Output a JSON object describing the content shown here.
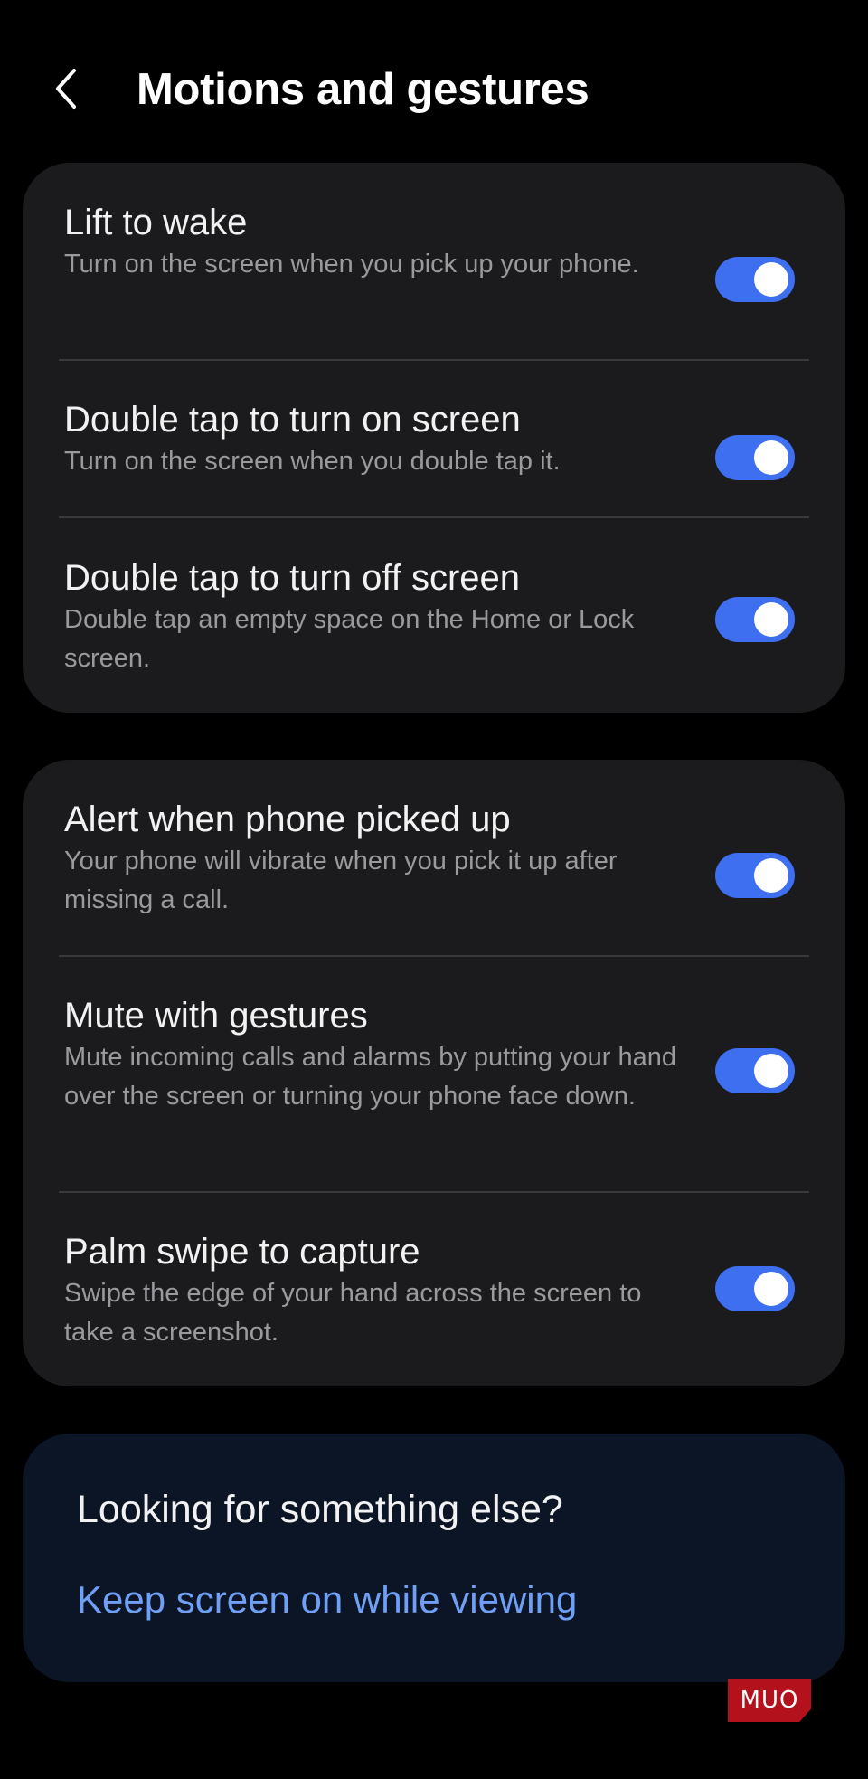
{
  "header": {
    "title": "Motions and gestures",
    "back_icon": "chevron-left-icon"
  },
  "colors": {
    "background": "#000000",
    "card": "#1b1b1d",
    "toggle_on": "#3e6ff1",
    "link": "#6fa0f6",
    "suggest_card": "#0c1526"
  },
  "group1": {
    "items": [
      {
        "title": "Lift to wake",
        "description": "Turn on the screen when you pick up your phone.",
        "enabled": true
      },
      {
        "title": "Double tap to turn on screen",
        "description": "Turn on the screen when you double tap it.",
        "enabled": true
      },
      {
        "title": "Double tap to turn off screen",
        "description": "Double tap an empty space on the Home or Lock screen.",
        "enabled": true
      }
    ]
  },
  "group2": {
    "items": [
      {
        "title": "Alert when phone picked up",
        "description": "Your phone will vibrate when you pick it up after missing a call.",
        "enabled": true
      },
      {
        "title": "Mute with gestures",
        "description": "Mute incoming calls and alarms by putting your hand over the screen or turning your phone face down.",
        "enabled": true
      },
      {
        "title": "Palm swipe to capture",
        "description": "Swipe the edge of your hand across the screen to take a screenshot.",
        "enabled": true
      }
    ]
  },
  "suggestions": {
    "title": "Looking for something else?",
    "link": "Keep screen on while viewing"
  },
  "watermark": {
    "text": "MUO"
  }
}
